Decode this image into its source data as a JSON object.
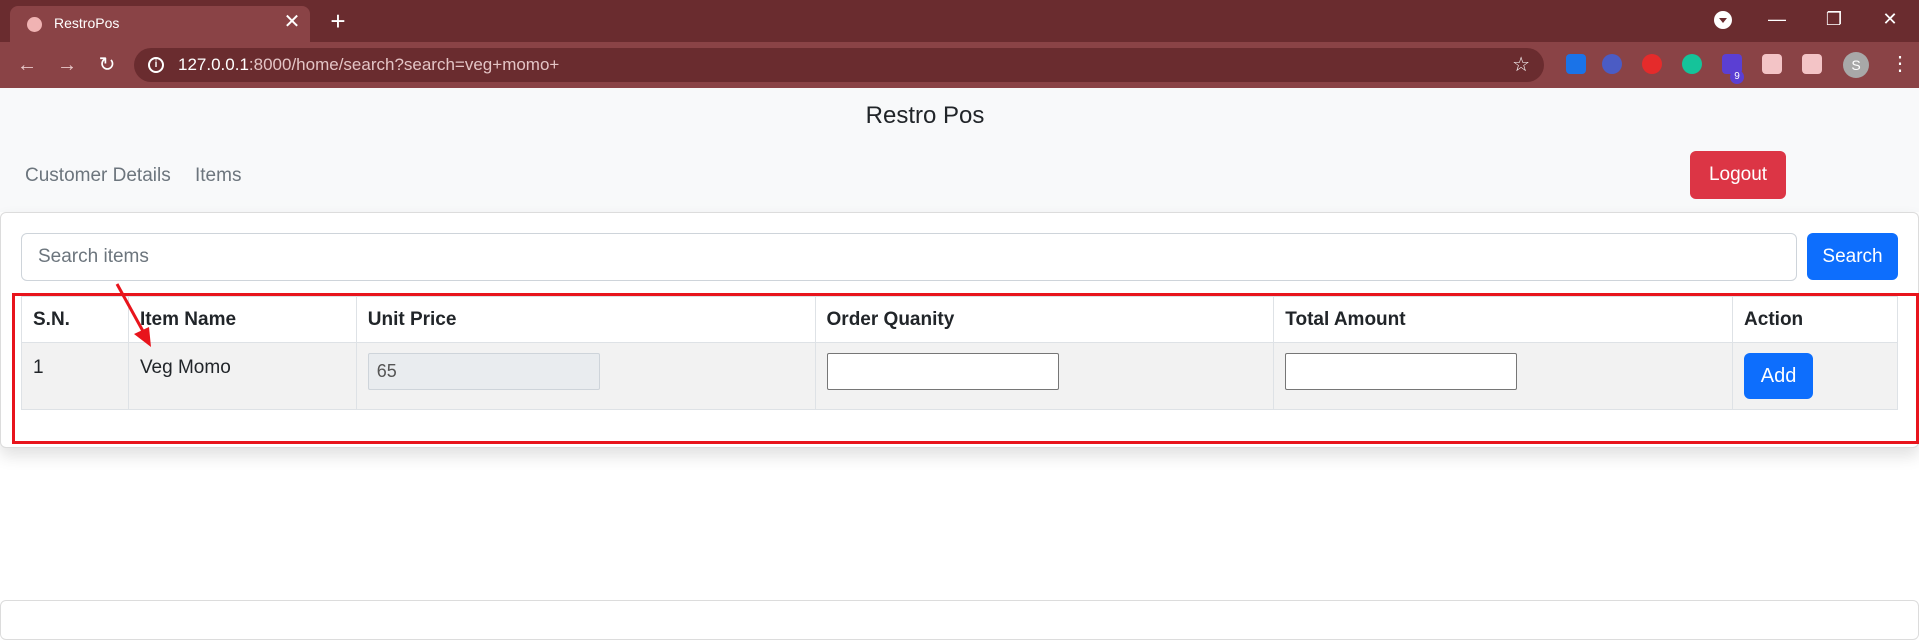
{
  "browser": {
    "tab_title": "RestroPos",
    "tab_close": "✕",
    "new_tab": "+",
    "window_controls": {
      "minimize": "—",
      "maximize": "❐",
      "close": "✕"
    },
    "nav": {
      "back": "←",
      "forward": "→",
      "reload": "↻"
    },
    "url_host": "127.0.0.1",
    "url_rest": ":8000/home/search?search=veg+momo+",
    "star": "☆",
    "extensions": [
      {
        "name": "translate-icon",
        "color": "#1a73e8"
      },
      {
        "name": "blocker-icon",
        "color": "#4b5cc4"
      },
      {
        "name": "stop-hand-icon",
        "color": "#e52b2b"
      },
      {
        "name": "grammarly-icon",
        "color": "#15c39a"
      },
      {
        "name": "cube-extension-icon",
        "color": "#5b3fd3"
      },
      {
        "name": "puzzle-icon",
        "color": "#f3c4c6"
      },
      {
        "name": "playlist-icon",
        "color": "#f3c4c6"
      }
    ],
    "extension_badge": "9",
    "avatar_letter": "S",
    "menu": "⋮"
  },
  "app": {
    "brand": "Restro Pos",
    "nav_links": [
      "Customer Details",
      "Items"
    ],
    "logout_label": "Logout",
    "search": {
      "placeholder": "Search items",
      "value": "",
      "button_label": "Search"
    },
    "table": {
      "headers": [
        "S.N.",
        "Item Name",
        "Unit Price",
        "Order Quanity",
        "Total Amount",
        "Action"
      ],
      "rows": [
        {
          "sn": "1",
          "item_name": "Veg Momo",
          "unit_price": "65",
          "order_quantity": "",
          "total_amount": "",
          "action_label": "Add"
        }
      ]
    }
  },
  "annotation_color": "#e8141c"
}
